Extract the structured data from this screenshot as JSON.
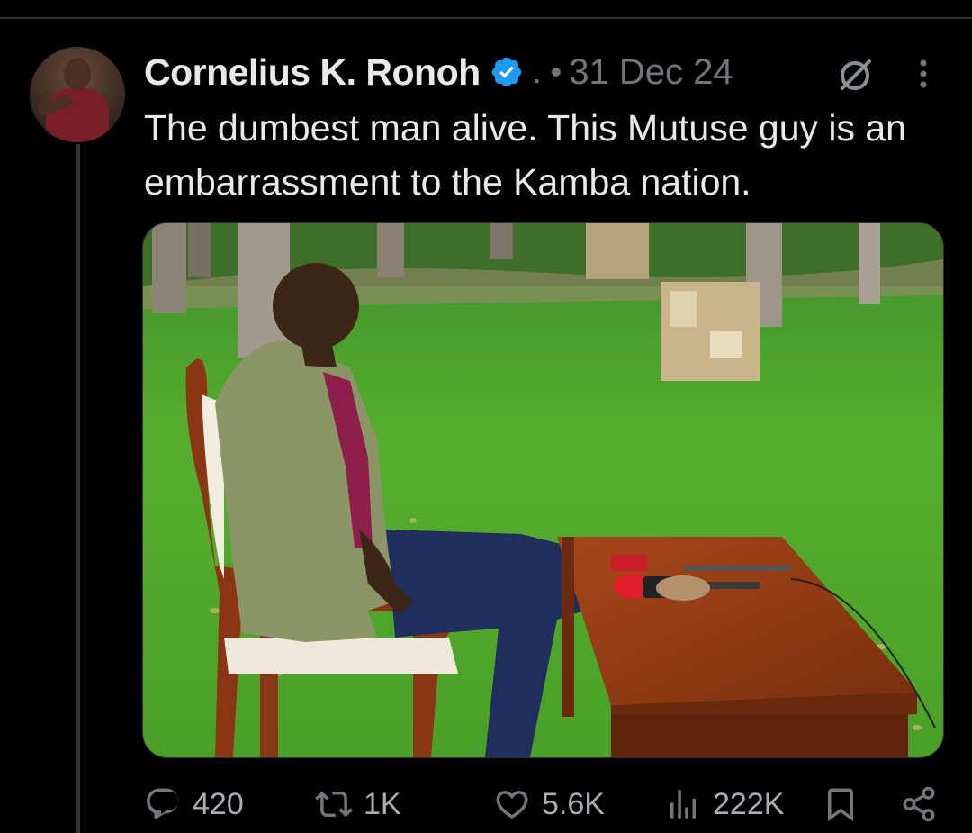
{
  "tweet": {
    "author_name": "Cornelius K. Ronoh",
    "separator": ". •",
    "date": "31 Dec 24",
    "text": "The dumbest man alive. This Mutuse guy is an embarrassment to the Kamba nation.",
    "icons": {
      "verified": "verified-badge-icon",
      "grok": "grok-icon",
      "more": "more-options-icon"
    },
    "media": {
      "description_colors": {
        "grass": "#4fa72a",
        "table": "#8a3a12",
        "jacket": "#7f8c55"
      }
    }
  },
  "actions": {
    "replies": "420",
    "reposts": "1K",
    "likes": "5.6K",
    "views": "222K"
  },
  "colors": {
    "background": "#000000",
    "text_primary": "#e7e9ea",
    "text_secondary": "#71767b",
    "verified": "#1d9bf0"
  }
}
